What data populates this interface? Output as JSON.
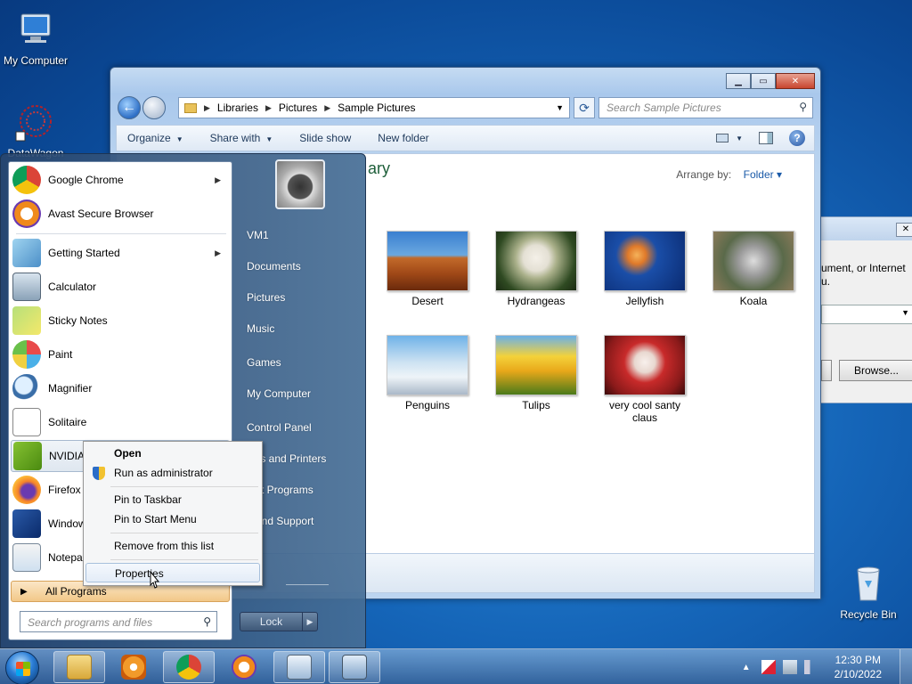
{
  "desktop": {
    "icons": [
      {
        "label": "My Computer"
      },
      {
        "label": "DataWagon"
      },
      {
        "label": "Recycle Bin"
      }
    ]
  },
  "explorer": {
    "breadcrumb": [
      "Libraries",
      "Pictures",
      "Sample Pictures"
    ],
    "search_placeholder": "Search Sample Pictures",
    "toolbar": {
      "organize": "Organize",
      "share_with": "Share with",
      "slide_show": "Slide show",
      "new_folder": "New folder"
    },
    "library_title": "ary",
    "arrange_by_label": "Arrange by:",
    "arrange_by_value": "Folder",
    "pictures": [
      {
        "label": "Desert"
      },
      {
        "label": "Hydrangeas"
      },
      {
        "label": "Jellyfish"
      },
      {
        "label": "Koala"
      },
      {
        "label": "Penguins"
      },
      {
        "label": "Tulips"
      },
      {
        "label": "very cool santy claus"
      }
    ]
  },
  "bg_dialog": {
    "text_line1": "ument, or Internet",
    "text_line2": "u.",
    "browse_label": "Browse..."
  },
  "start_menu": {
    "programs": [
      {
        "label": "Google Chrome",
        "has_submenu": true
      },
      {
        "label": "Avast Secure Browser",
        "has_submenu": false
      },
      {
        "label": "Getting Started",
        "has_submenu": true
      },
      {
        "label": "Calculator",
        "has_submenu": false
      },
      {
        "label": "Sticky Notes",
        "has_submenu": false
      },
      {
        "label": "Paint",
        "has_submenu": false
      },
      {
        "label": "Magnifier",
        "has_submenu": false
      },
      {
        "label": "Solitaire",
        "has_submenu": false
      },
      {
        "label": "NVIDIA",
        "has_submenu": false
      },
      {
        "label": "Firefox",
        "has_submenu": false
      },
      {
        "label": "Window",
        "has_submenu": false
      },
      {
        "label": "Notepad",
        "has_submenu": false
      }
    ],
    "all_programs": "All Programs",
    "search_placeholder": "Search programs and files",
    "right_items": [
      "VM1",
      "Documents",
      "Pictures",
      "Music",
      "Games",
      "My Computer",
      "Control Panel",
      "ices and Printers",
      "ault Programs",
      "p and Support"
    ],
    "lock_label": "Lock"
  },
  "context_menu": {
    "items": [
      {
        "label": "Open"
      },
      {
        "label": "Run as administrator"
      },
      {
        "label": "Pin to Taskbar"
      },
      {
        "label": "Pin to Start Menu"
      },
      {
        "label": "Remove from this list"
      },
      {
        "label": "Properties"
      }
    ]
  },
  "taskbar": {
    "time": "12:30 PM",
    "date": "2/10/2022"
  }
}
